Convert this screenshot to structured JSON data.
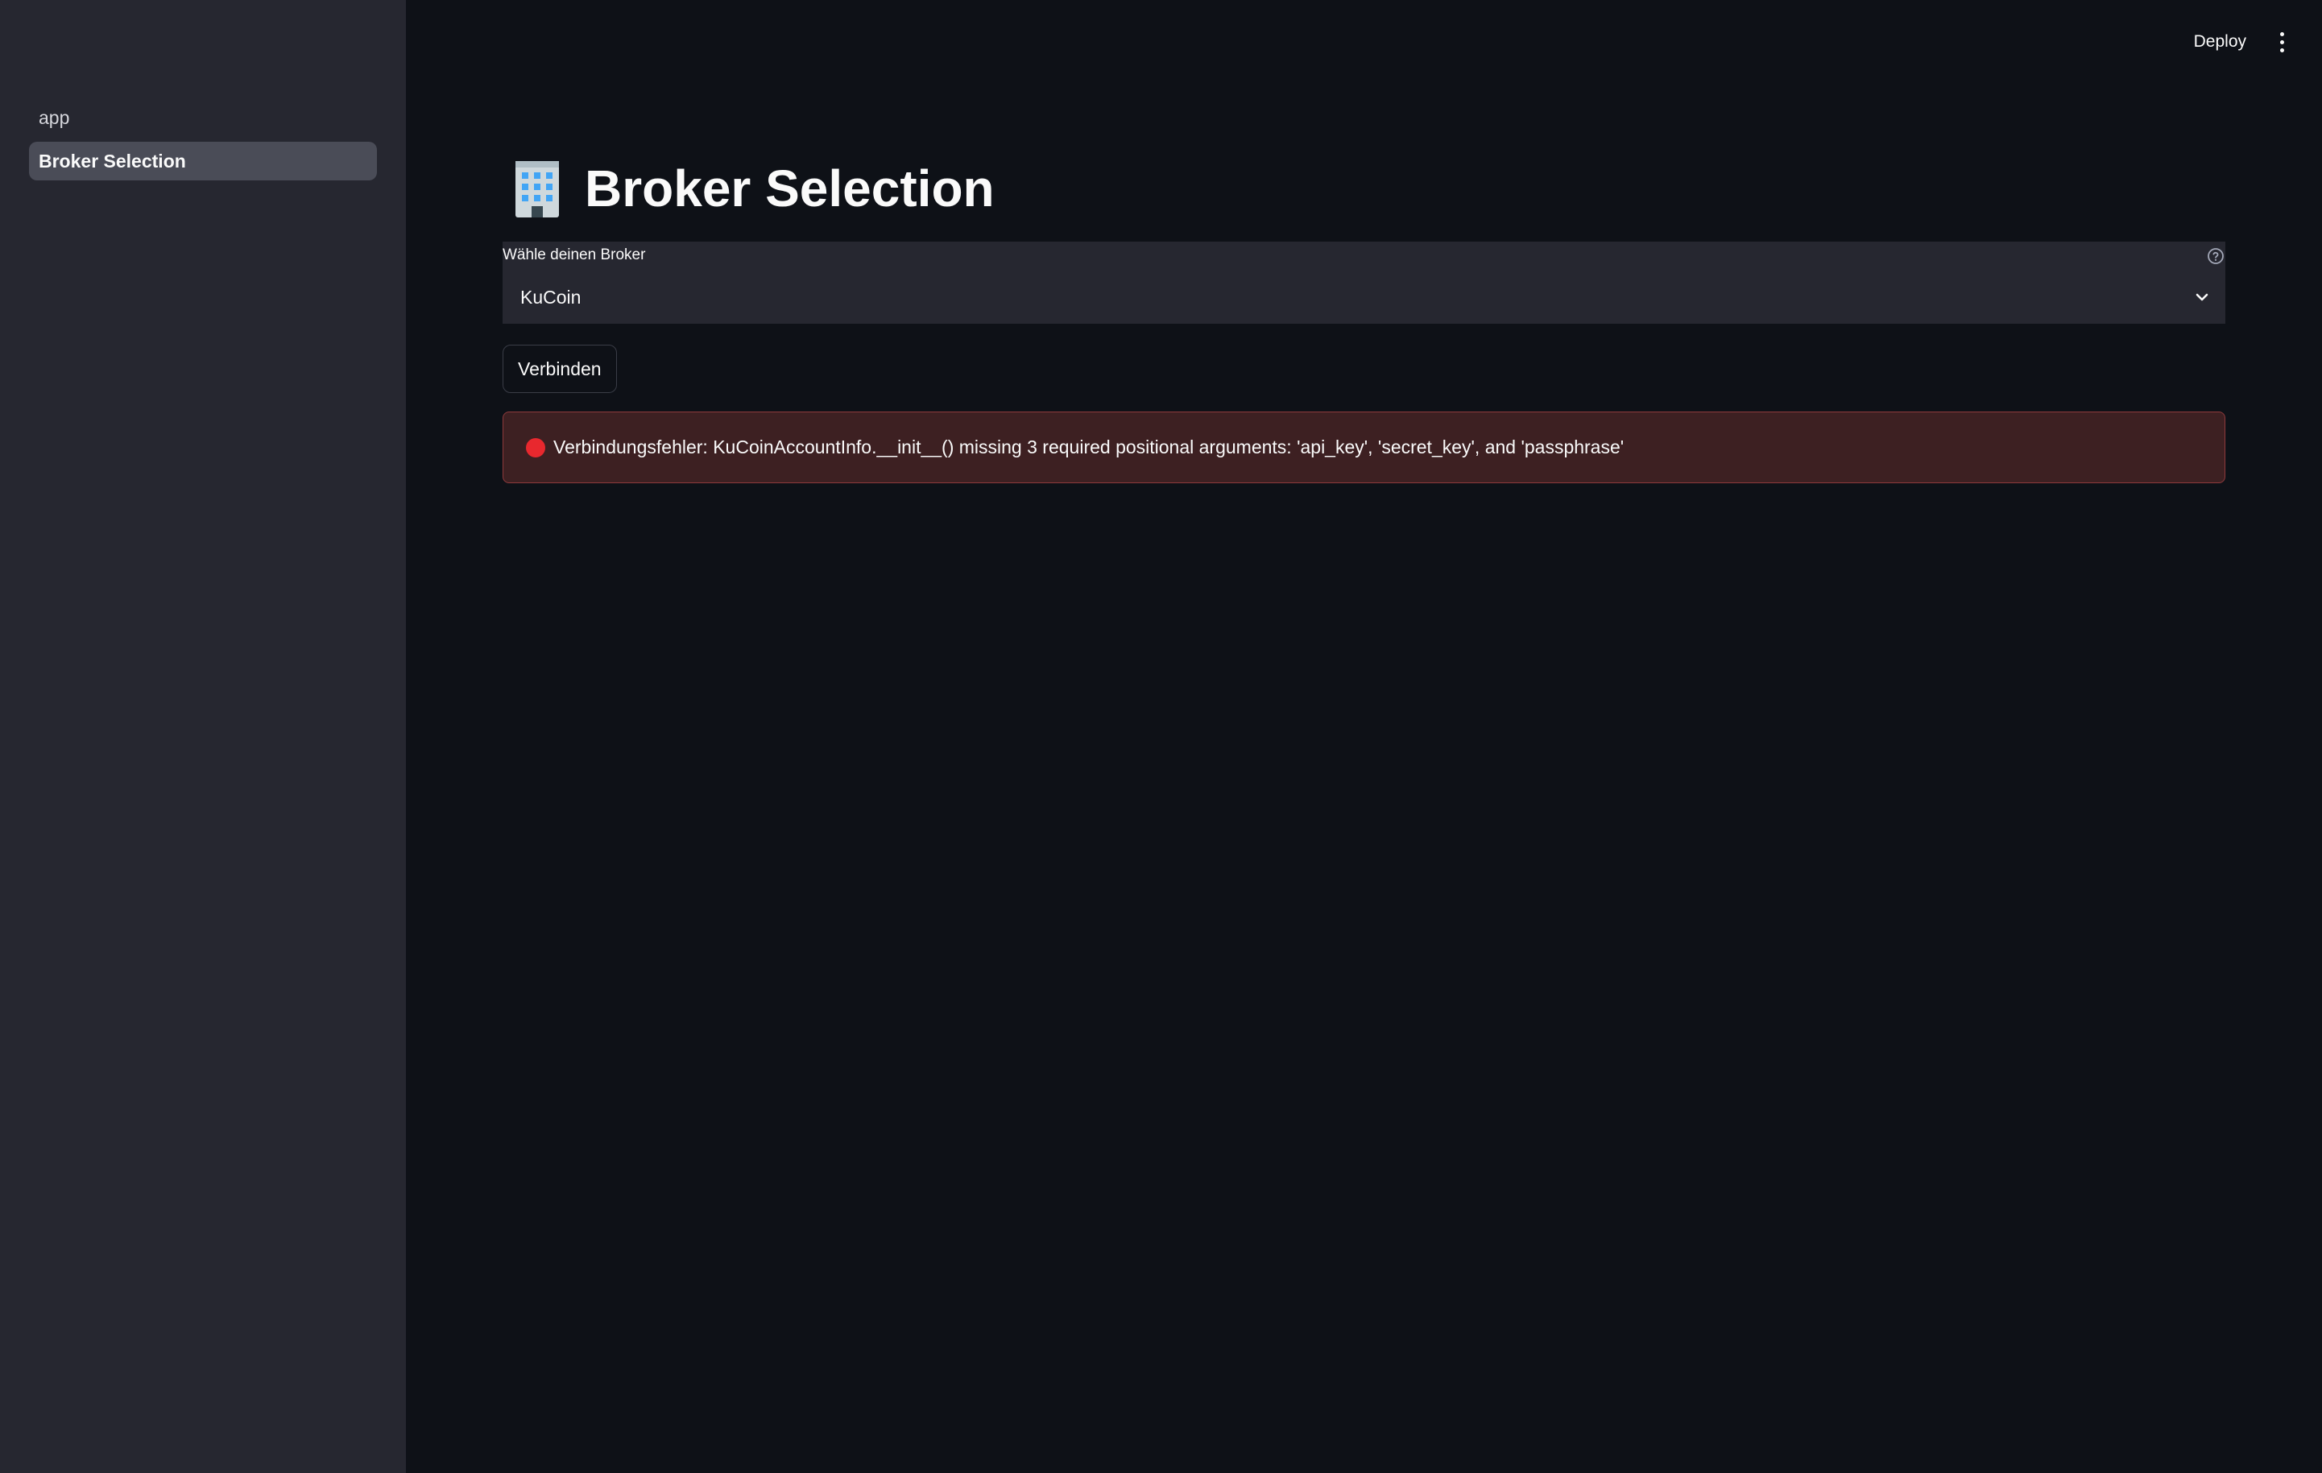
{
  "sidebar": {
    "items": [
      {
        "label": "app",
        "active": false
      },
      {
        "label": "Broker Selection",
        "active": true
      }
    ]
  },
  "header": {
    "deploy_label": "Deploy",
    "menu_icon": "kebab-menu-icon"
  },
  "main": {
    "title_icon": "office-building-icon",
    "title": "Broker Selection",
    "broker_select": {
      "label": "Wähle deinen Broker",
      "help_icon": "question-circle-icon",
      "value": "KuCoin"
    },
    "connect_button_label": "Verbinden",
    "error": {
      "icon": "red-circle-icon",
      "message": "Verbindungsfehler: KuCoinAccountInfo.__init__() missing 3 required positional arguments: 'api_key', 'secret_key', and 'passphrase'"
    }
  },
  "colors": {
    "app_background": "#0e1117",
    "sidebar_background": "#262730",
    "error_background": "#3d2022",
    "error_accent": "#e8282e"
  }
}
